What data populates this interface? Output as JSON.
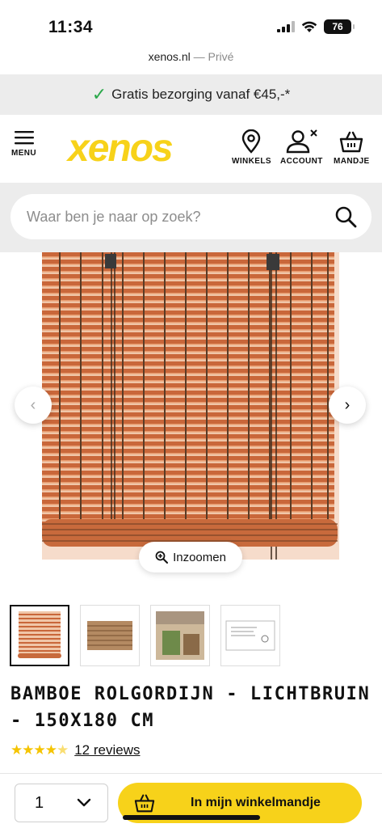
{
  "status": {
    "time": "11:34",
    "battery": "76"
  },
  "url": {
    "domain": "xenos.nl",
    "separator": "—",
    "mode": "Privé"
  },
  "promo": {
    "text": "Gratis bezorging vanaf €45,-*"
  },
  "header": {
    "logo": "xenos",
    "menu_label": "MENU",
    "winkels_label": "WINKELS",
    "account_label": "ACCOUNT",
    "mandje_label": "MANDJE"
  },
  "search": {
    "placeholder": "Waar ben je naar op zoek?"
  },
  "gallery": {
    "zoom_label": "Inzoomen",
    "thumbnail_count": 4
  },
  "product": {
    "title": "BAMBOE ROLGORDIJN - LICHTBRUIN - 150X180 CM",
    "rating": 4.5,
    "reviews": "12 reviews"
  },
  "cart": {
    "quantity": "1",
    "add_label": "In mijn winkelmandje"
  },
  "colors": {
    "brand_yellow": "#f7d21a",
    "promo_check": "#2aa84a",
    "star": "#f5c400"
  }
}
